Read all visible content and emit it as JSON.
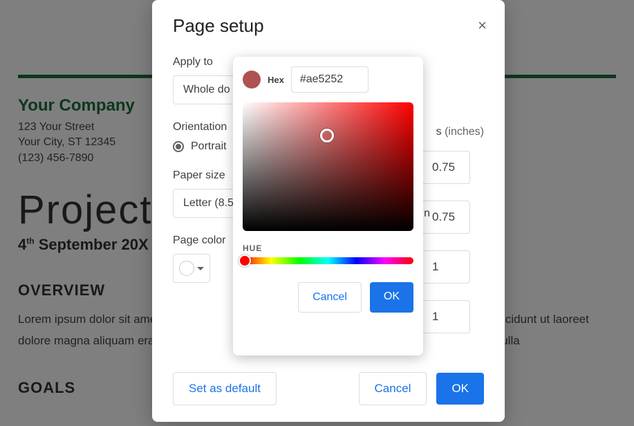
{
  "document": {
    "company": "Your Company",
    "street": "123 Your Street",
    "city_line": "Your City, ST 12345",
    "phone": "(123) 456-7890",
    "title": "Project",
    "date_html": "4th September 20X",
    "overview_h": "OVERVIEW",
    "overview_body": "Lorem ipsum dolor sit amet, consectetuer adipiscing elit, sed diam nonummy nibh euismod tincidunt ut laoreet dolore magna aliquam erat volutpat. Ut wisi enim ad minim veniam quis nostrud exerci tation ulla",
    "goals_h": "GOALS"
  },
  "dialog": {
    "title": "Page setup",
    "apply_to_label": "Apply to",
    "apply_to_value": "Whole do",
    "orientation_label": "Orientation",
    "portrait_label": "Portrait",
    "paper_size_label": "Paper size",
    "paper_size_value": "Letter (8.5",
    "page_color_label": "Page color",
    "margins_label": "s",
    "margins_unit": "(inches)",
    "margins": {
      "top": "0.75",
      "bottom": "0.75",
      "left": "1",
      "right": "1"
    },
    "margin_bottom_partial": "n",
    "set_default": "Set as default",
    "cancel": "Cancel",
    "ok": "OK"
  },
  "picker": {
    "hex_label": "Hex",
    "hex_value": "#ae5252",
    "hue_label": "HUE",
    "preview_color": "#ae5252",
    "cancel": "Cancel",
    "ok": "OK"
  }
}
